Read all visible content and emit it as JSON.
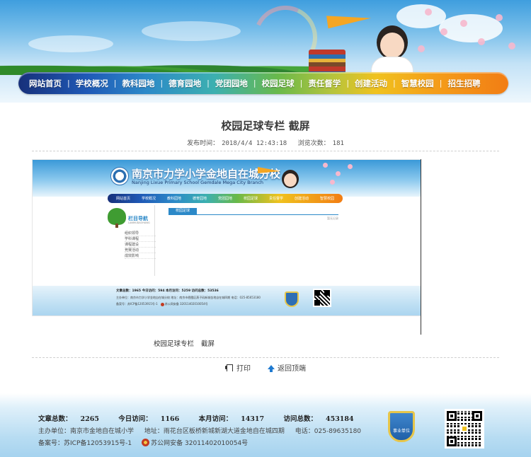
{
  "nav": {
    "items": [
      "网站首页",
      "学校概况",
      "教科园地",
      "德育园地",
      "党团园地",
      "校园足球",
      "责任督学",
      "创建活动",
      "智慧校园",
      "招生招聘"
    ]
  },
  "article": {
    "title": "校园足球专栏 截屏",
    "publish_label": "发布时间：",
    "publish_time": "2018/4/4 12:43:18",
    "views_label": "浏览次数：",
    "views": "181",
    "caption_a": "校园足球专栏",
    "caption_b": "截屏"
  },
  "screenshot": {
    "school_cn": "南京市力学小学金地自在城分校",
    "school_en": "Nanjing Lixue Primary School Gemdale Mega City Branch",
    "nav": [
      "网站首页",
      "学校概况",
      "教科园地",
      "德育园地",
      "党团园地",
      "校园足球",
      "责任督学",
      "创建活动",
      "智慧校园"
    ],
    "column_title": "栏目导航",
    "column_sub": "LANMUDAOHANG",
    "side_items": [
      "组织领导",
      "学科课程",
      "课程建设",
      "竞赛活动",
      "成效影响"
    ],
    "main_tab": "校园足球",
    "main_right": "暂无记录",
    "footer_line1": "文章总数：1965  今日访问：594  本月访问：5259  访问总数：53536",
    "footer_line2": "主办单位：南京市力学小学金地自在城分校  地址：南京市栖霞区燕子矶新城金地自在城四期  电话：025-85653180",
    "footer_line3_a": "备案号：苏ICP备12053915号-1",
    "footer_line3_b": "苏公网安备 32011402010054号"
  },
  "actions": {
    "print": "打印",
    "back_top": "返回顶端"
  },
  "footer": {
    "stats": {
      "articles_label": "文章总数：",
      "articles": "2265",
      "today_label": "今日访问：",
      "today": "1166",
      "month_label": "本月访问：",
      "month": "14317",
      "total_label": "访问总数：",
      "total": "453184"
    },
    "sponsor": "主办单位：南京市金地自在城小学",
    "address": "地址：雨花台区板桥新城新湖大道金地自在城四期",
    "phone": "电话：025-89635180",
    "icp": "备案号：苏ICP备12053915号-1",
    "police": "苏公网安备 32011402010054号",
    "badge_label": "事业单位"
  },
  "colors": {
    "nav_start": "#17307a",
    "nav_end": "#f27d14",
    "link_blue": "#1f7ad0"
  }
}
